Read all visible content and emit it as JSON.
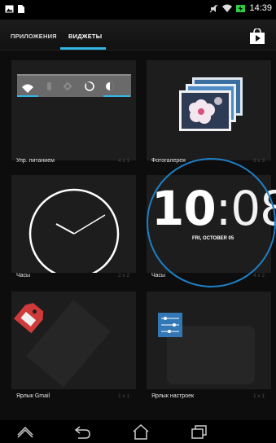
{
  "status_bar": {
    "time": "14:39",
    "icons": [
      "image-icon",
      "file-icon",
      "mute-icon",
      "wifi-icon",
      "battery-charging-icon"
    ]
  },
  "tabs": [
    {
      "label": "ПРИЛОЖЕНИЯ",
      "selected": false
    },
    {
      "label": "ВИДЖЕТЫ",
      "selected": true
    }
  ],
  "store_icon": "play-store-icon",
  "accent_color": "#33b5e5",
  "widgets": [
    {
      "label": "Упр. питанием",
      "size": "4 x 1"
    },
    {
      "label": "Фотогалерея",
      "size": "3 x 3"
    },
    {
      "label": "Часы",
      "size": "2 x 2"
    },
    {
      "label": "Часы",
      "size": "4 x 2"
    },
    {
      "label": "Ярлык Gmail",
      "size": "1 x 1"
    },
    {
      "label": "Ярлык настроек",
      "size": "1 x 1"
    }
  ],
  "digital_clock": {
    "hours": "10",
    "separator": ":",
    "minutes": "08",
    "date": "FRI, OCTOBER 05"
  },
  "nav_bar": [
    "back-alt-icon",
    "back-icon",
    "home-icon",
    "recent-apps-icon"
  ]
}
